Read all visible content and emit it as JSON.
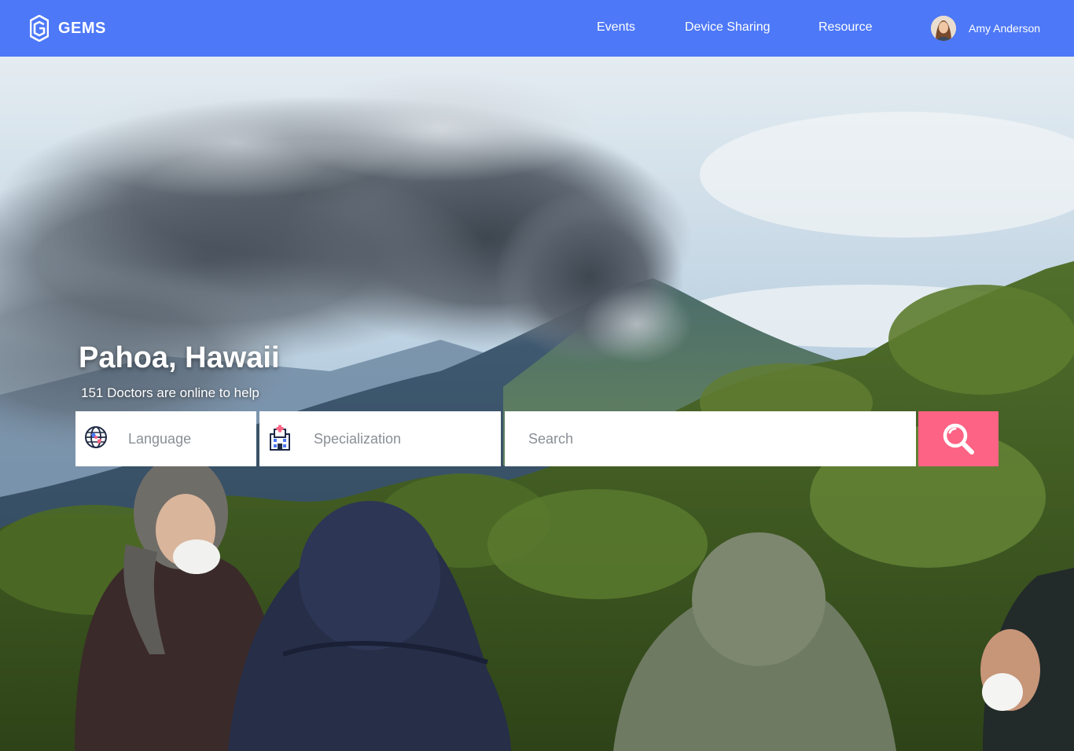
{
  "brand": {
    "name": "GEMS"
  },
  "nav": {
    "events": "Events",
    "device_sharing": "Device Sharing",
    "resource": "Resource"
  },
  "user": {
    "name": "Amy Anderson"
  },
  "hero": {
    "location": "Pahoa, Hawaii",
    "subtitle": "151 Doctors are online to help"
  },
  "search": {
    "language_label": "Language",
    "specialization_label": "Specialization",
    "search_placeholder": "Search",
    "language_icon": "globe-icon",
    "specialization_icon": "hospital-icon",
    "submit_icon": "search-icon"
  },
  "colors": {
    "header": "#4d78f7",
    "search_button": "#fd6385"
  }
}
